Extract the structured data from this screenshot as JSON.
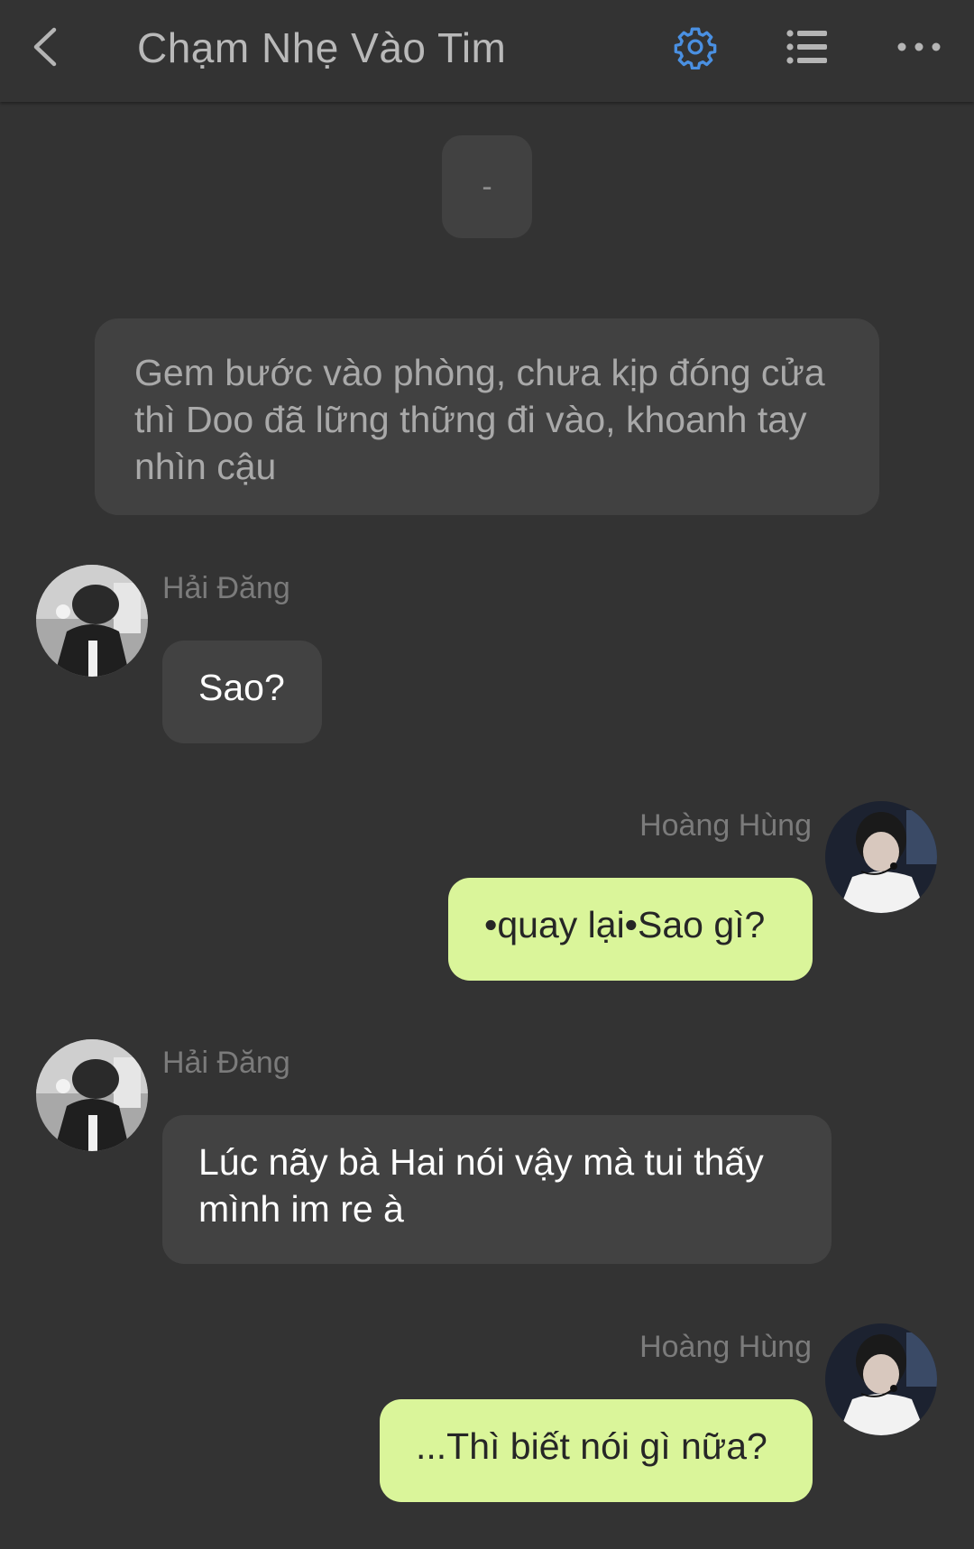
{
  "header": {
    "title": "Chạm Nhẹ Vào Tim",
    "back_icon": "chevron-left-icon",
    "settings_icon": "gear-icon",
    "list_icon": "list-icon",
    "more_icon": "more-horizontal-icon",
    "accent_color": "#4a90e2"
  },
  "colors": {
    "background": "#333333",
    "narration_bubble": "#414141",
    "left_bubble": "#424242",
    "right_bubble": "#daf59a"
  },
  "messages": [
    {
      "type": "narration",
      "text": "-"
    },
    {
      "type": "narration",
      "text": "Gem bước vào phòng, chưa kịp đóng cửa thì Doo đã lững thững đi vào, khoanh tay nhìn cậu"
    },
    {
      "type": "left",
      "sender": "Hải Đăng",
      "text": "Sao?"
    },
    {
      "type": "right",
      "sender": "Hoàng Hùng",
      "text": "•quay lại•Sao gì?"
    },
    {
      "type": "left",
      "sender": "Hải Đăng",
      "text": "Lúc nãy bà Hai nói vậy mà tui thấy mình im re à"
    },
    {
      "type": "right",
      "sender": "Hoàng Hùng",
      "text": "...Thì biết nói gì nữa?"
    }
  ]
}
